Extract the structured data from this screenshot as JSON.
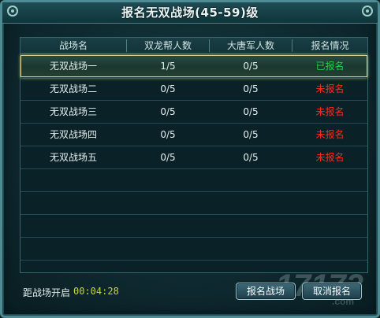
{
  "window": {
    "title": "报名无双战场(45-59)级"
  },
  "table": {
    "headers": [
      "战场名",
      "双龙帮人数",
      "大唐军人数",
      "报名情况"
    ],
    "rows": [
      {
        "name": "无双战场一",
        "team1": "1/5",
        "team2": "0/5",
        "status": "已报名",
        "registered": true
      },
      {
        "name": "无双战场二",
        "team1": "0/5",
        "team2": "0/5",
        "status": "未报名",
        "registered": false
      },
      {
        "name": "无双战场三",
        "team1": "0/5",
        "team2": "0/5",
        "status": "未报名",
        "registered": false
      },
      {
        "name": "无双战场四",
        "team1": "0/5",
        "team2": "0/5",
        "status": "未报名",
        "registered": false
      },
      {
        "name": "无双战场五",
        "team1": "0/5",
        "team2": "0/5",
        "status": "未报名",
        "registered": false
      }
    ]
  },
  "footer": {
    "countdown_label": "距战场开启",
    "countdown_value": "00:04:28",
    "register_button": "报名战场",
    "cancel_button": "取消报名"
  },
  "colors": {
    "registered": "#1fd24a",
    "unregistered": "#ff2a18",
    "countdown": "#c5d63a"
  },
  "watermark": {
    "main": "17173",
    "domain": ".com"
  }
}
